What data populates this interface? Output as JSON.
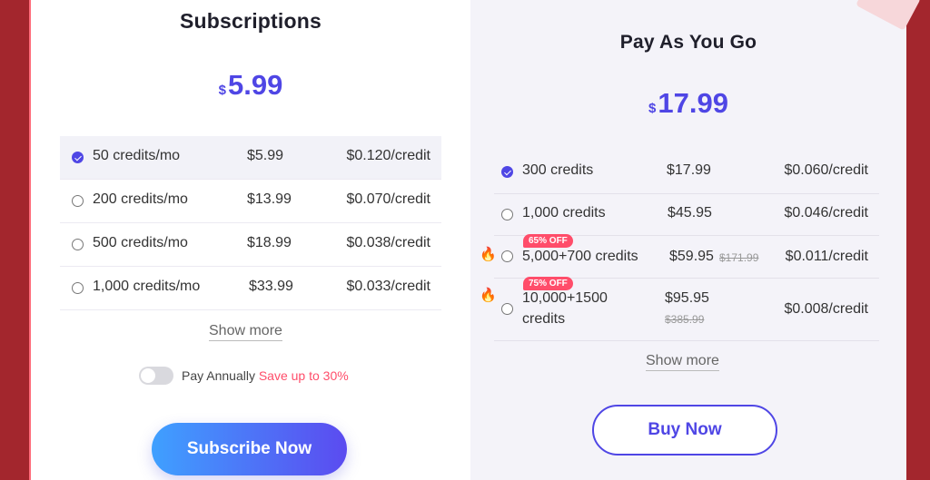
{
  "subscriptions": {
    "title": "Subscriptions",
    "price_currency": "$",
    "price_value": "5.99",
    "plans": [
      {
        "label": "50 credits/mo",
        "price": "$5.99",
        "per_credit": "$0.120/credit",
        "selected": true
      },
      {
        "label": "200 credits/mo",
        "price": "$13.99",
        "per_credit": "$0.070/credit",
        "selected": false
      },
      {
        "label": "500 credits/mo",
        "price": "$18.99",
        "per_credit": "$0.038/credit",
        "selected": false
      },
      {
        "label": "1,000 credits/mo",
        "price": "$33.99",
        "per_credit": "$0.033/credit",
        "selected": false
      }
    ],
    "show_more": "Show more",
    "annual_label": "Pay Annually",
    "annual_save": "Save up to 30%",
    "annual_enabled": false,
    "cta": "Subscribe Now"
  },
  "payg": {
    "title": "Pay As You Go",
    "price_currency": "$",
    "price_value": "17.99",
    "plans": [
      {
        "label": "300 credits",
        "price": "$17.99",
        "per_credit": "$0.060/credit",
        "selected": true
      },
      {
        "label": "1,000 credits",
        "price": "$45.95",
        "per_credit": "$0.046/credit",
        "selected": false
      },
      {
        "label": "5,000+700 credits",
        "price": "$59.95",
        "old_price": "$171.99",
        "per_credit": "$0.011/credit",
        "badge": "65% OFF",
        "selected": false
      },
      {
        "label_line1": "10,000+1500",
        "label_line2": "credits",
        "price": "$95.95",
        "old_price": "$385.99",
        "per_credit": "$0.008/credit",
        "badge": "75% OFF",
        "selected": false
      }
    ],
    "show_more": "Show more",
    "cta": "Buy Now"
  },
  "icons": {
    "fire": "fire-icon",
    "check": "check-icon"
  },
  "colors": {
    "accent": "#4f46e5",
    "sale": "#ff4d6a",
    "background": "#a3262d"
  }
}
